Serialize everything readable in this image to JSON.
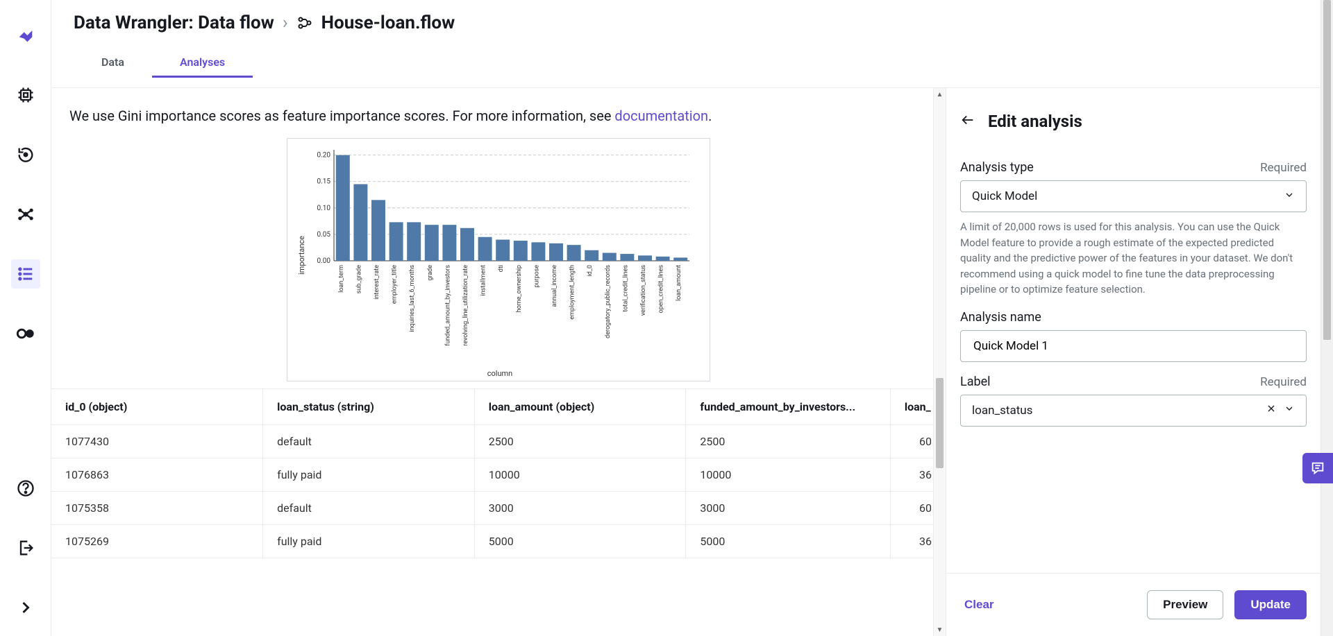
{
  "breadcrumb": {
    "root": "Data Wrangler: Data flow",
    "file": "House-loan.flow"
  },
  "tabs": {
    "data": "Data",
    "analyses": "Analyses"
  },
  "intro": {
    "text": "We use Gini importance scores as feature importance scores. For more information, see ",
    "link": "documentation",
    "period": "."
  },
  "chart_data": {
    "type": "bar",
    "ylabel": "importance",
    "xlabel": "column",
    "ylim": [
      0,
      0.21
    ],
    "yticks": [
      0.0,
      0.05,
      0.1,
      0.15,
      0.2
    ],
    "categories": [
      "loan_term",
      "sub_grade",
      "interest_rate",
      "employer_title",
      "inquiries_last_6_months",
      "grade",
      "funded_amount_by_investors",
      "revolving_line_utilization_rate",
      "installment",
      "dti",
      "home_ownership",
      "purpose",
      "annual_income",
      "employment_length",
      "id_0",
      "derogatory_public_records",
      "total_credit_lines",
      "verification_status",
      "open_credit_lines",
      "loan_amount"
    ],
    "values": [
      0.2,
      0.145,
      0.115,
      0.073,
      0.073,
      0.068,
      0.068,
      0.062,
      0.045,
      0.04,
      0.038,
      0.035,
      0.033,
      0.03,
      0.02,
      0.015,
      0.013,
      0.01,
      0.008,
      0.006
    ]
  },
  "table": {
    "headers": [
      "id_0 (object)",
      "loan_status (string)",
      "loan_amount (object)",
      "funded_amount_by_investors...",
      "loan_"
    ],
    "rows": [
      [
        "1077430",
        "default",
        "2500",
        "2500",
        "60"
      ],
      [
        "1076863",
        "fully paid",
        "10000",
        "10000",
        "36"
      ],
      [
        "1075358",
        "default",
        "3000",
        "3000",
        "60"
      ],
      [
        "1075269",
        "fully paid",
        "5000",
        "5000",
        "36"
      ]
    ]
  },
  "panel": {
    "title": "Edit analysis",
    "analysis_type_label": "Analysis type",
    "required": "Required",
    "analysis_type_value": "Quick Model",
    "help": "A limit of 20,000 rows is used for this analysis. You can use the Quick Model feature to provide a rough estimate of the expected predicted quality and the predictive power of the features in your dataset. We don't recommend using a quick model to fine tune the data preprocessing pipeline or to optimize feature selection.",
    "analysis_name_label": "Analysis name",
    "analysis_name_value": "Quick Model 1",
    "label_label": "Label",
    "label_value": "loan_status",
    "clear": "Clear",
    "preview": "Preview",
    "update": "Update"
  }
}
